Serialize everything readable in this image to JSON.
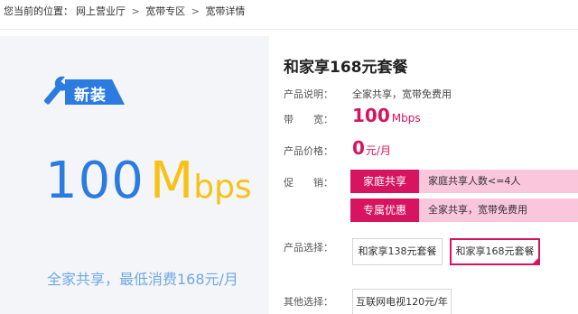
{
  "breadcrumb": {
    "prefix": "您当前的位置：",
    "items": [
      "网上营业厅",
      "宽带专区",
      "宽带详情"
    ],
    "separator": ">"
  },
  "banner": {
    "badge": "新装",
    "speed_number": "100",
    "speed_m": "M",
    "speed_bps": "bps",
    "slogan": "全家共享，最低消费168元/月",
    "colors": {
      "blue": "#2b7be0",
      "yellow": "#f5c215",
      "background": "#f4f5f8"
    }
  },
  "product": {
    "title": "和家享168元套餐",
    "desc_label": "产品说明：",
    "desc_value": "全家共享，宽带免费用",
    "bandwidth_label": "带　　宽：",
    "bandwidth_value": "100",
    "bandwidth_unit": "Mbps",
    "price_label": "产品价格：",
    "price_value": "0",
    "price_unit": "元/月",
    "promo_label": "促　　销：",
    "promos": [
      {
        "tag": "家庭共享",
        "text": "家庭共享人数<=4人"
      },
      {
        "tag": "专属优惠",
        "text": "全家共享，宽带免费用"
      }
    ],
    "select_label": "产品选择：",
    "options": [
      {
        "label": "和家享138元套餐",
        "selected": false
      },
      {
        "label": "和家享168元套餐",
        "selected": true
      }
    ],
    "other_label": "其他选择：",
    "other_options": [
      "互联网电视120元/年"
    ],
    "accent_color": "#d6145f"
  }
}
